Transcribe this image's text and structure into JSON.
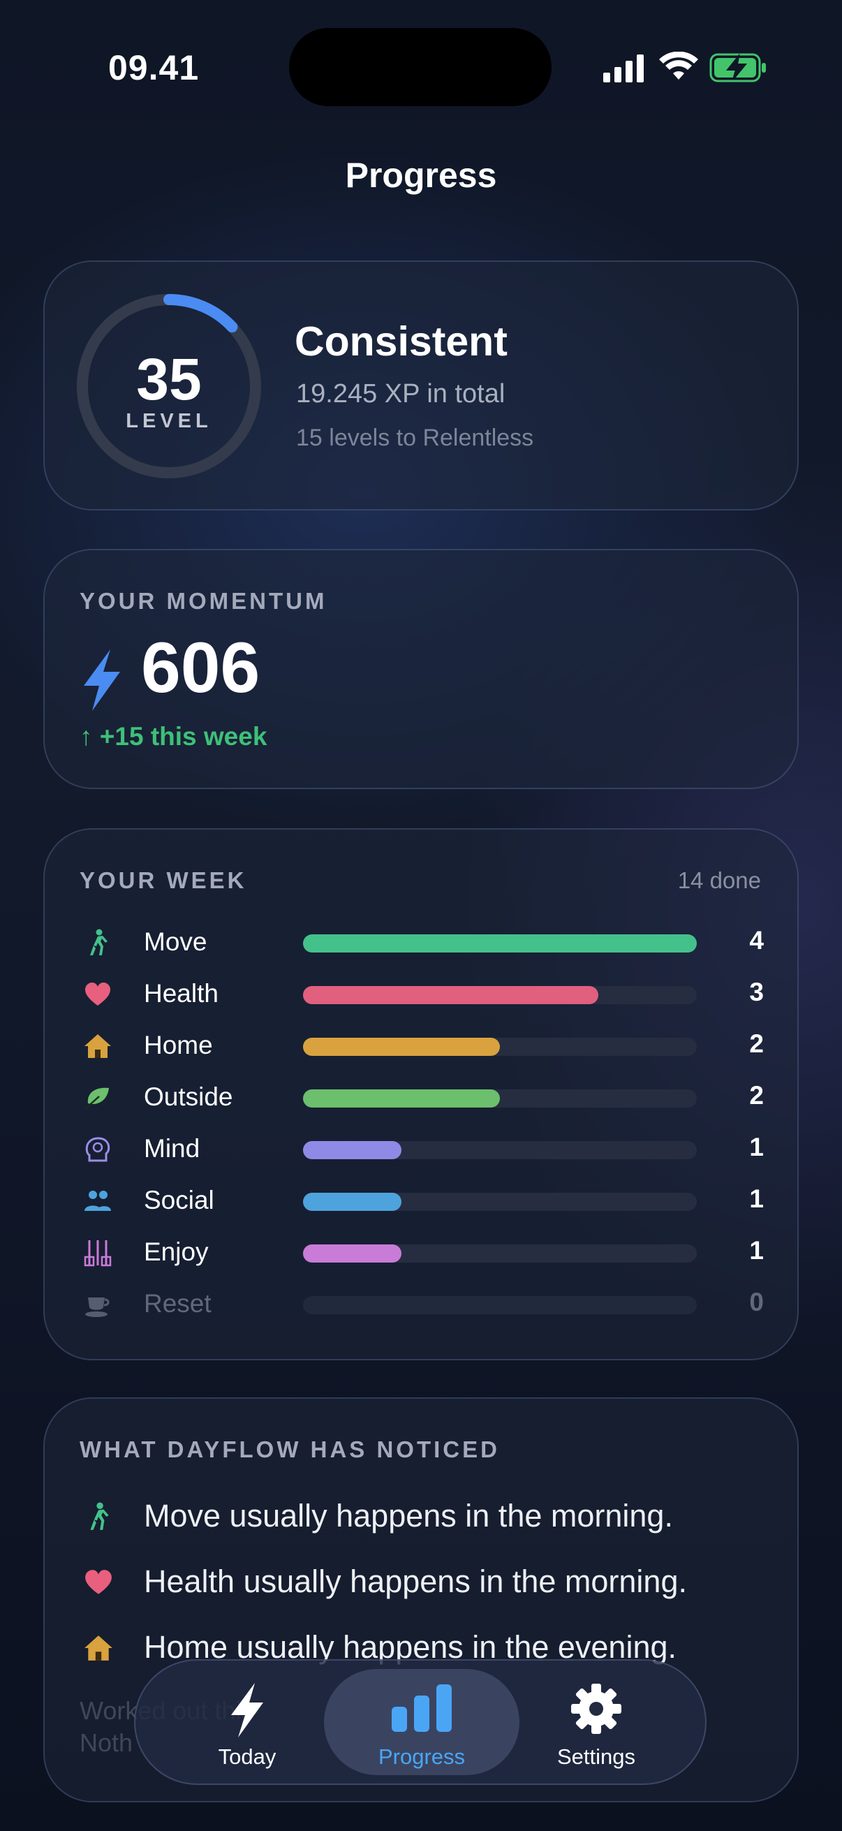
{
  "status": {
    "time": "09.41"
  },
  "page": {
    "title": "Progress"
  },
  "level": {
    "number": "35",
    "label": "LEVEL",
    "rank": "Consistent",
    "xp_total": "19.245 XP in total",
    "next": "15 levels to Relentless",
    "ring_progress": 0.13,
    "accent": "#4a8cf2"
  },
  "momentum": {
    "label": "YOUR MOMENTUM",
    "icon": "bolt-icon",
    "value": "606",
    "delta": "↑ +15 this week",
    "delta_color": "#3ec078"
  },
  "week": {
    "label": "YOUR WEEK",
    "done": "14 done",
    "max": 4,
    "items": [
      {
        "name": "Move",
        "count": "4",
        "value": 4,
        "color": "#44c18b",
        "icon": "walking-icon"
      },
      {
        "name": "Health",
        "count": "3",
        "value": 3,
        "color": "#e0607e",
        "icon": "heart-icon"
      },
      {
        "name": "Home",
        "count": "2",
        "value": 2,
        "color": "#d9a23f",
        "icon": "house-icon"
      },
      {
        "name": "Outside",
        "count": "2",
        "value": 2,
        "color": "#6cbf6c",
        "icon": "leaf-icon"
      },
      {
        "name": "Mind",
        "count": "1",
        "value": 1,
        "color": "#8f8ae6",
        "icon": "brain-icon"
      },
      {
        "name": "Social",
        "count": "1",
        "value": 1,
        "color": "#4ea3dd",
        "icon": "people-icon"
      },
      {
        "name": "Enjoy",
        "count": "1",
        "value": 1,
        "color": "#c97bd8",
        "icon": "guitar-icon"
      },
      {
        "name": "Reset",
        "count": "0",
        "value": 0,
        "color": "#6b7283",
        "icon": "cup-icon"
      }
    ]
  },
  "noticed": {
    "label": "WHAT DAYFLOW HAS NOTICED",
    "items": [
      {
        "text": "Move usually happens in the morning.",
        "icon": "walking-icon"
      },
      {
        "text": "Health usually happens in the morning.",
        "icon": "heart-icon"
      },
      {
        "text": "Home usually happens in the evening.",
        "icon": "house-icon"
      }
    ],
    "faded": [
      "Worked out this",
      "Noth"
    ]
  },
  "tabs": [
    {
      "label": "Today",
      "icon": "bolt-icon",
      "active": false
    },
    {
      "label": "Progress",
      "icon": "bar-chart-icon",
      "active": true,
      "color": "#4aa6f5"
    },
    {
      "label": "Settings",
      "icon": "gear-icon",
      "active": false
    }
  ]
}
